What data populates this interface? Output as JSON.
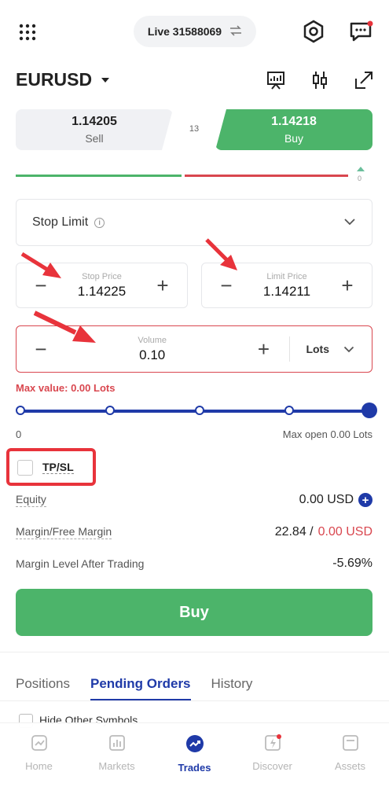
{
  "header": {
    "account_label": "Live 31588069",
    "icons": [
      "grid-menu-icon",
      "swap-icon",
      "settings-hexagon-icon",
      "message-icon"
    ]
  },
  "symbol": {
    "name": "EURUSD",
    "toolbar_icons": [
      "chart-presentation-icon",
      "candlestick-icon",
      "expand-icon"
    ]
  },
  "quote": {
    "sell_price": "1.14205",
    "sell_label": "Sell",
    "buy_price": "1.14218",
    "buy_label": "Buy",
    "spread": "13",
    "sentiment_value": "0"
  },
  "order_type": {
    "label": "Stop Limit",
    "info_glyph": "i"
  },
  "stop_price": {
    "caption": "Stop Price",
    "value": "1.14225"
  },
  "limit_price": {
    "caption": "Limit Price",
    "value": "1.14211"
  },
  "volume": {
    "caption": "Volume",
    "value": "0.10",
    "unit": "Lots"
  },
  "validation": {
    "max_value": "Max value: 0.00 Lots"
  },
  "slider": {
    "min_label": "0",
    "max_label": "Max open 0.00 Lots",
    "level": 1.0
  },
  "tpsl": {
    "label": "TP/SL",
    "checked": false
  },
  "account_info": {
    "equity_label": "Equity",
    "equity_value": "0.00 USD",
    "margin_label": "Margin/Free Margin",
    "margin_value": "22.84 /",
    "free_margin_value": "0.00 USD",
    "margin_level_label": "Margin Level After Trading",
    "margin_level_value": "-5.69%"
  },
  "submit": {
    "label": "Buy"
  },
  "tabs": [
    {
      "label": "Positions",
      "active": false
    },
    {
      "label": "Pending Orders",
      "active": true
    },
    {
      "label": "History",
      "active": false
    }
  ],
  "filter": {
    "hide_other_symbols": "Hide Other Symbols"
  },
  "bottom_nav": [
    {
      "label": "Home",
      "icon": "home-chart-icon",
      "active": false
    },
    {
      "label": "Markets",
      "icon": "markets-bar-icon",
      "active": false
    },
    {
      "label": "Trades",
      "icon": "trades-trend-icon",
      "active": true
    },
    {
      "label": "Discover",
      "icon": "discover-lightning-icon",
      "active": false
    },
    {
      "label": "Assets",
      "icon": "assets-wallet-icon",
      "active": false
    }
  ],
  "colors": {
    "buy_green": "#4cb46a",
    "sell_red": "#d9474f",
    "accent_blue": "#1f3aa8",
    "annotation_red": "#e8333b"
  }
}
